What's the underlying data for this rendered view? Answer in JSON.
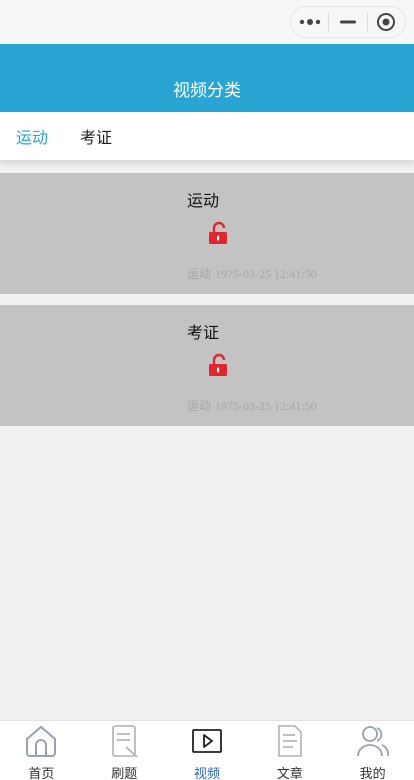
{
  "header": {
    "title": "视频分类"
  },
  "tabs": [
    {
      "label": "运动",
      "active": true
    },
    {
      "label": "考证",
      "active": false
    }
  ],
  "categories": [
    {
      "name": "运动",
      "tag": "运动",
      "date": "1975-03-25 12:41:50",
      "lock_icon": "unlocked-icon"
    },
    {
      "name": "考证",
      "tag": "运动",
      "date": "1975-03-25 12:41:50",
      "lock_icon": "unlocked-icon"
    }
  ],
  "bottom_nav": [
    {
      "label": "首页",
      "icon": "home-icon",
      "active": false
    },
    {
      "label": "刷题",
      "icon": "quiz-icon",
      "active": false
    },
    {
      "label": "视频",
      "icon": "video-icon",
      "active": true
    },
    {
      "label": "文章",
      "icon": "article-icon",
      "active": false
    },
    {
      "label": "我的",
      "icon": "profile-icon",
      "active": false
    }
  ],
  "colors": {
    "accent": "#29a5d4",
    "card_bg": "#c3c3c3",
    "lock": "#e0262c",
    "nav_active": "#2a66b8"
  }
}
